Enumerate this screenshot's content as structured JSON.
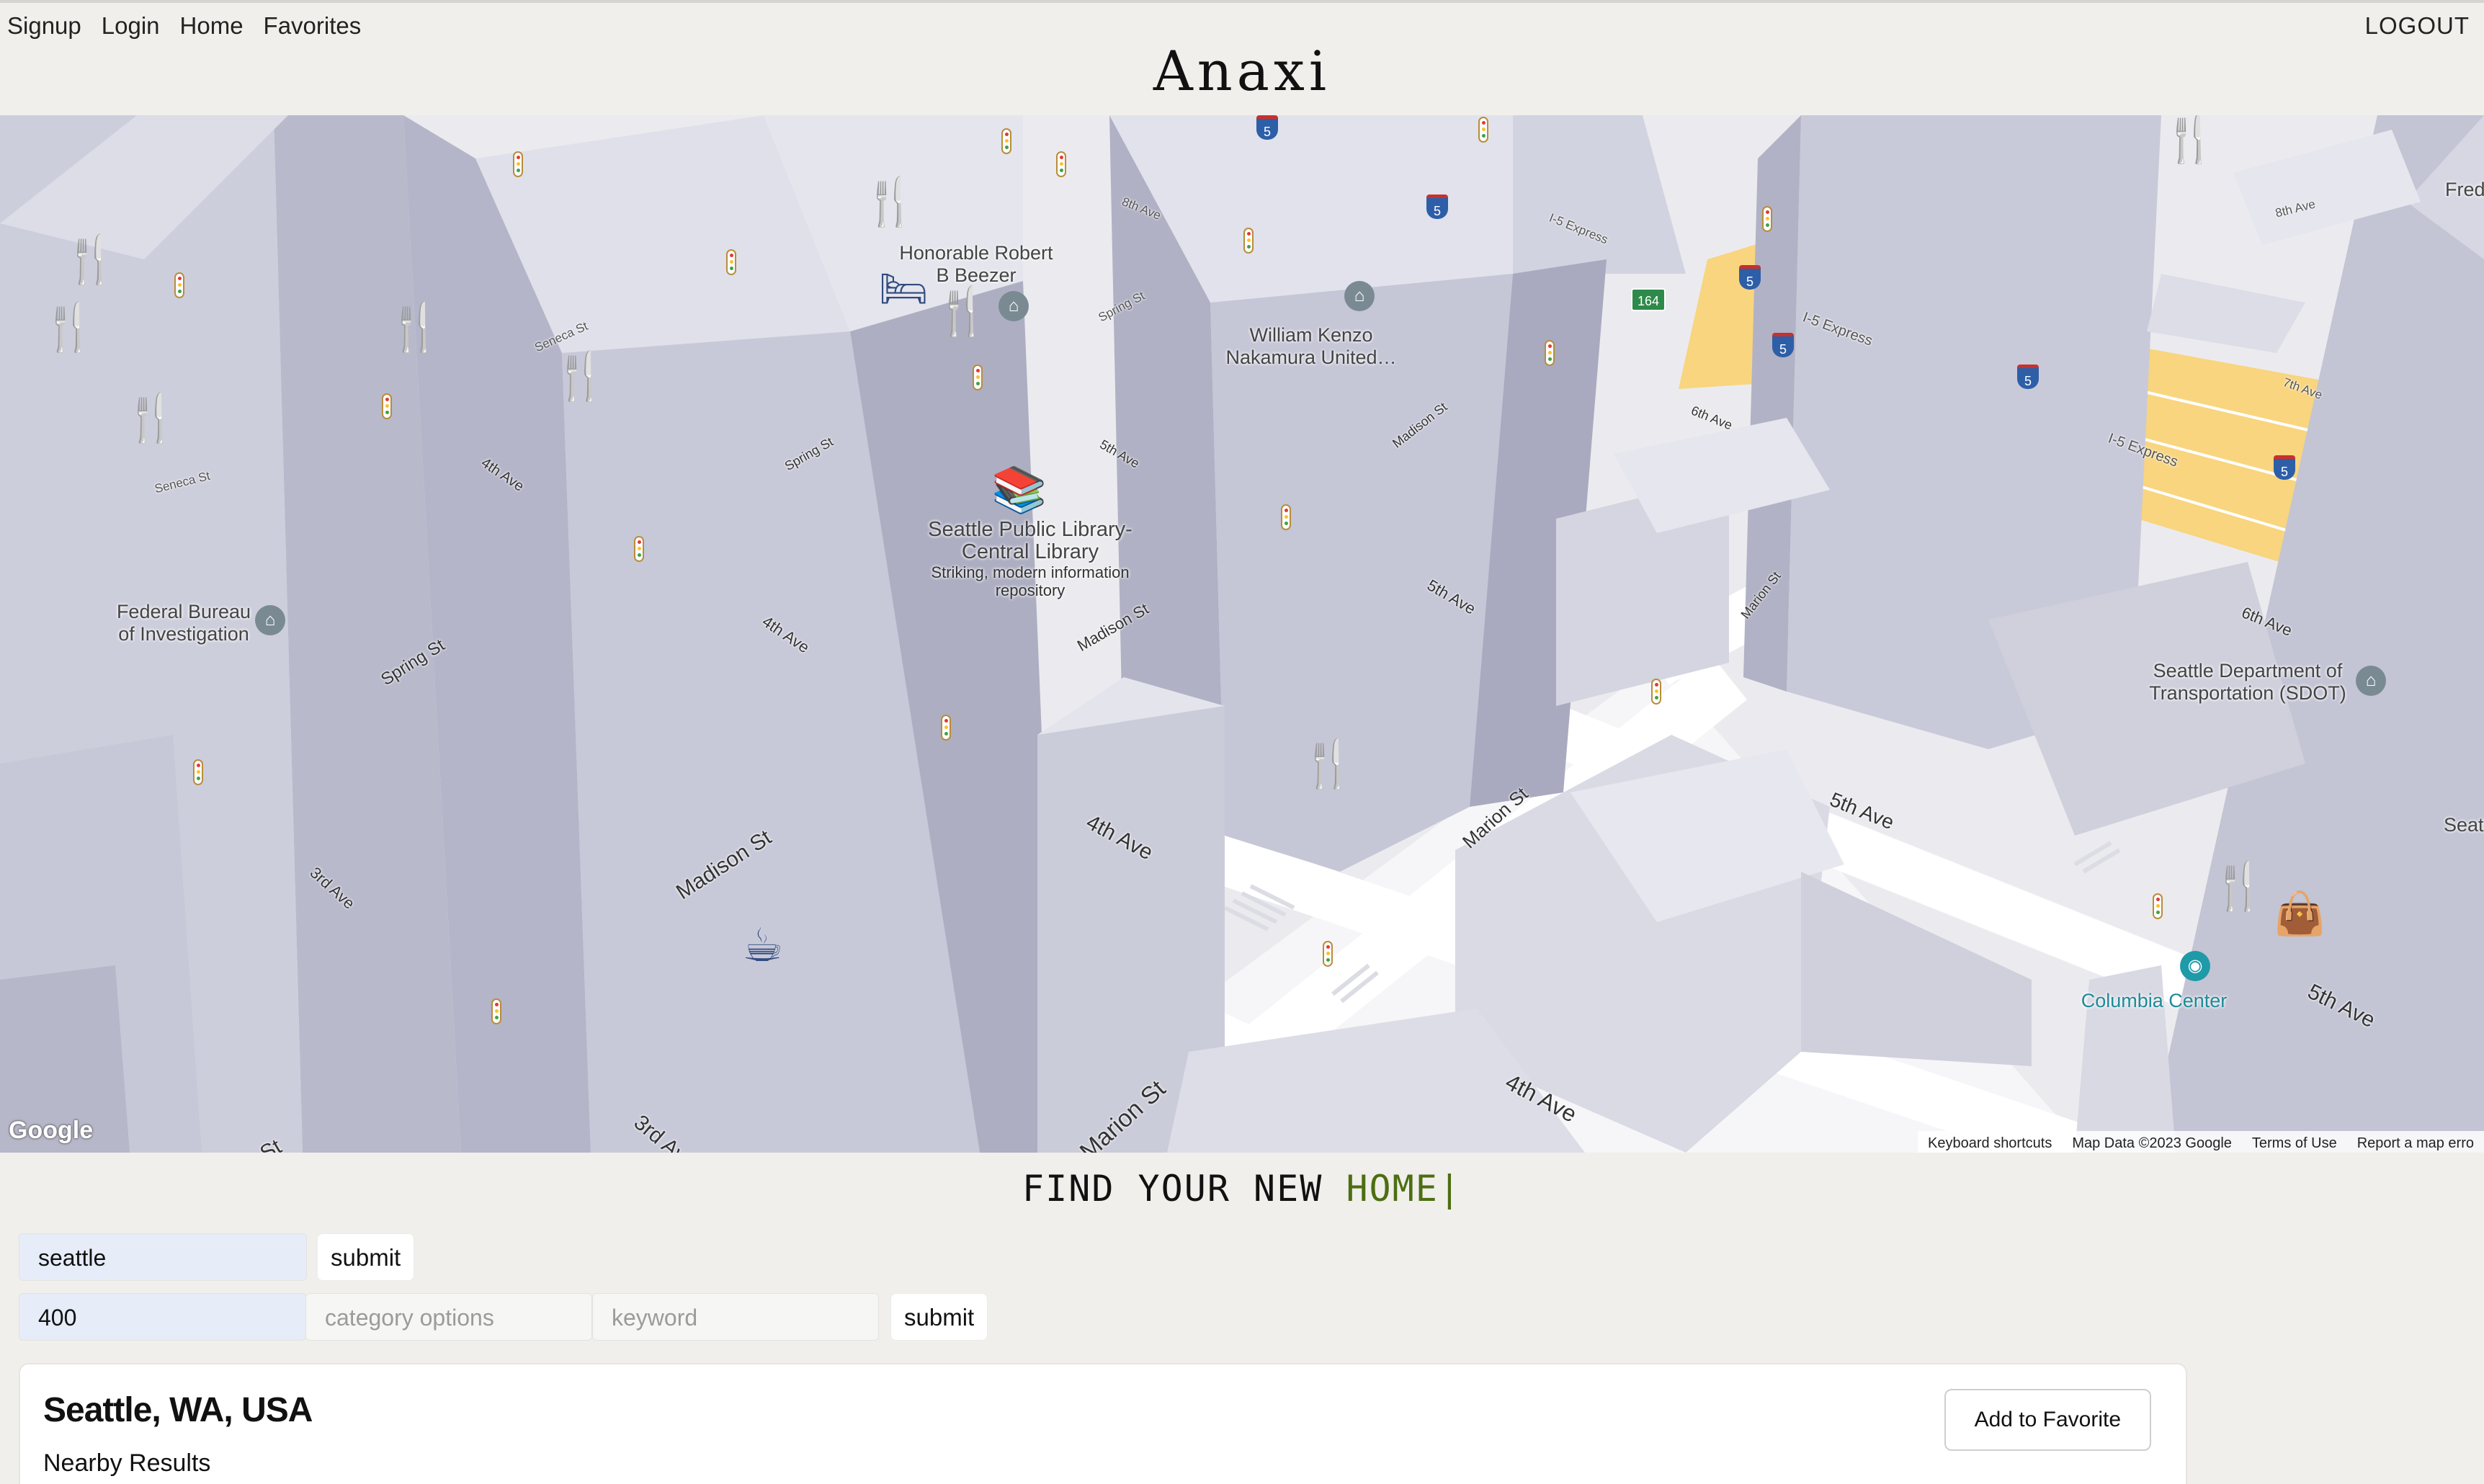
{
  "nav": {
    "links": [
      "Signup",
      "Login",
      "Home",
      "Favorites"
    ],
    "logout": "LOGOUT"
  },
  "brand": "Anaxi",
  "map": {
    "places": {
      "library_name": "Seattle Public Library-Central Library",
      "library_desc": "Striking, modern information repository",
      "honorable": "Honorable Robert B Beezer",
      "nakamura": "William Kenzo Nakamura United…",
      "fbi": "Federal Bureau of Investigation",
      "sdot": "Seattle Department of Transportation (SDOT)",
      "columbia": "Columbia Center",
      "fred": "Fred",
      "seatt": "Seatt"
    },
    "streets": {
      "madison_st": "Madison St",
      "fourth_ave": "4th Ave",
      "fifth_ave": "5th Ave",
      "sixth_ave": "6th Ave",
      "marion_st": "Marion St",
      "spring_st": "Spring St",
      "third_ave": "3rd Ave",
      "seneca_st": "Seneca St",
      "i5_express": "I-5 Express",
      "seventh_ave": "7th Ave",
      "eighth_ave": "8th Ave",
      "st_fragment": "St"
    },
    "route_shield": "164",
    "interstate": "5",
    "google": "Google",
    "footer": [
      "Keyboard shortcuts",
      "Map Data ©2023 Google",
      "Terms of Use",
      "Report a map erro"
    ],
    "colors": {
      "poi_icon": "#2f4a7e",
      "building": "#c9cad9",
      "road": "#ffffff",
      "highway": "#f8d57e"
    }
  },
  "headline": {
    "prefix": "FIND YOUR NEW ",
    "accent": "HOME",
    "cursor": "|",
    "accent_color": "#4d6e12"
  },
  "search": {
    "location_value": "seattle",
    "submit_label": "submit",
    "radius_value": "400",
    "category_placeholder": "category options",
    "keyword_placeholder": "keyword",
    "submit2_label": "submit"
  },
  "result": {
    "title": "Seattle, WA, USA",
    "subtitle": "Nearby Results",
    "fav_label": "Add to Favorite"
  }
}
